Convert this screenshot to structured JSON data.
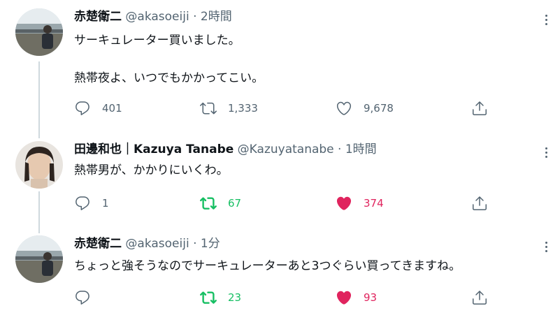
{
  "tweets": [
    {
      "name": "赤楚衛二",
      "handle": "@akasoeiji",
      "dot": "·",
      "time": "2時間",
      "lines": [
        "サーキュレーター買いました。",
        "熱帯夜よ、いつでもかかってこい。"
      ],
      "reply_count": "401",
      "retweet_count": "1,333",
      "like_count": "9,678"
    },
    {
      "name": "田邊和也｜Kazuya Tanabe",
      "handle": "@Kazuyatanabe",
      "dot": "·",
      "time": "1時間",
      "lines": [
        "熱帯男が、かかりにいくわ。"
      ],
      "reply_count": "1",
      "retweet_count": "67",
      "like_count": "374"
    },
    {
      "name": "赤楚衛二",
      "handle": "@akasoeiji",
      "dot": "·",
      "time": "1分",
      "lines": [
        "ちょっと強そうなのでサーキュレーターあと3つぐらい買ってきますね。"
      ],
      "reply_count": "",
      "retweet_count": "23",
      "like_count": "93"
    }
  ],
  "colors": {
    "retweet_active": "#17bf63",
    "like_active": "#e0245e",
    "secondary_text": "#536471",
    "thread_line": "#cfd9de"
  },
  "icons": [
    "reply-icon",
    "retweet-icon",
    "like-icon",
    "share-icon",
    "more-icon"
  ]
}
